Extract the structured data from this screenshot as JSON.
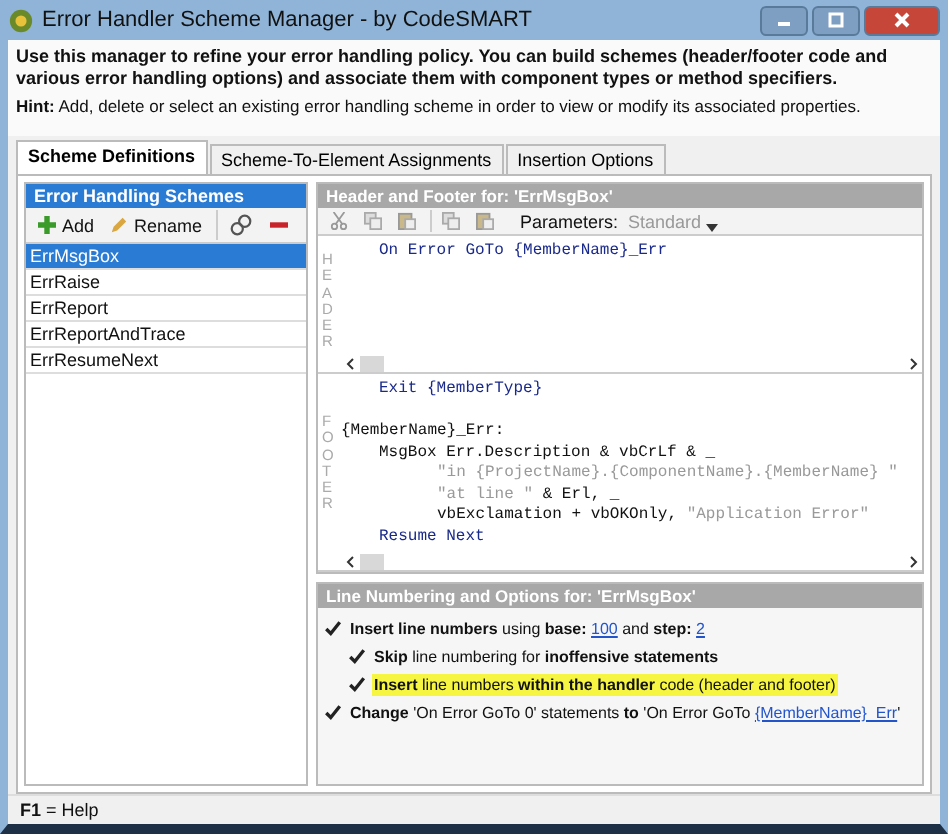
{
  "window": {
    "title": "Error Handler Scheme Manager - by CodeSMART"
  },
  "intro": {
    "description": "Use this manager to refine your error handling policy. You can build schemes (header/footer code and various error handling options) and associate them with component types or method specifiers.",
    "hint": "**Hint:** Add, delete or select an existing error handling scheme in order to view or modify its associated properties."
  },
  "tabs": [
    {
      "label": "Scheme Definitions",
      "selected": true
    },
    {
      "label": "Scheme-To-Element Assignments",
      "selected": false
    },
    {
      "label": "Insertion Options",
      "selected": false
    }
  ],
  "schemes": {
    "title": "Error Handling Schemes",
    "toolbar": [
      {
        "kind": "add",
        "label": "Add"
      },
      {
        "kind": "rename",
        "label": "Rename"
      },
      {
        "kind": "link"
      },
      {
        "kind": "delete"
      }
    ],
    "items": [
      {
        "label": "ErrMsgBox",
        "selected": true
      },
      {
        "label": "ErrRaise",
        "selected": false
      },
      {
        "label": "ErrReport",
        "selected": false
      },
      {
        "label": "ErrReportAndTrace",
        "selected": false
      },
      {
        "label": "ErrResumeNext",
        "selected": false
      }
    ]
  },
  "editor": {
    "title": "Header and Footer for: 'ErrMsgBox'",
    "toolbar": [
      {
        "kind": "cut"
      },
      {
        "kind": "copy"
      },
      {
        "kind": "paste"
      },
      {
        "kind": "copy"
      },
      {
        "kind": "paste"
      }
    ],
    "parameters_label": "Parameters:",
    "parameters_value": "Standard",
    "sections": [
      {
        "label": "HEADER",
        "lines": [
          {
            "kind": "statement",
            "segments": [
              {
                "kind": "keyword",
                "text": "On Error GoTo {MemberName}_Err"
              }
            ]
          }
        ]
      },
      {
        "label": "FOOTER",
        "lines": [
          {
            "kind": "statement",
            "segments": [
              {
                "kind": "keyword",
                "text": "Exit {MemberType}"
              }
            ]
          },
          {
            "kind": "blank"
          },
          {
            "kind": "label",
            "segments": [
              {
                "kind": "plain",
                "text": "{MemberName}_Err:"
              }
            ]
          },
          {
            "kind": "statement",
            "segments": [
              {
                "kind": "plain",
                "text": "MsgBox Err.Description & vbCrLf & _"
              }
            ]
          },
          {
            "kind": "continuation",
            "segments": [
              {
                "kind": "string",
                "text": "\"in {ProjectName}.{ComponentName}.{MemberName} \""
              }
            ]
          },
          {
            "kind": "continuation",
            "segments": [
              {
                "kind": "string",
                "text": "\"at line \""
              },
              {
                "kind": "plain",
                "text": " & Erl, _"
              }
            ]
          },
          {
            "kind": "continuation",
            "segments": [
              {
                "kind": "plain",
                "text": "vbExclamation + vbOKOnly, "
              },
              {
                "kind": "string",
                "text": "\"Application Error\""
              }
            ]
          },
          {
            "kind": "statement",
            "segments": [
              {
                "kind": "keyword",
                "text": "Resume Next"
              }
            ]
          }
        ]
      }
    ]
  },
  "options": {
    "title": "Line Numbering and Options for: 'ErrMsgBox'",
    "items": [
      {
        "checked": true,
        "highlighted": false,
        "parts": [
          {
            "kind": "text",
            "text": "**Insert line numbers** using **base:** "
          },
          {
            "kind": "link",
            "text": "100"
          },
          {
            "kind": "text",
            "text": " and **step:** "
          },
          {
            "kind": "link",
            "text": "2"
          }
        ],
        "children": [
          {
            "checked": true,
            "highlighted": false,
            "parts": [
              {
                "kind": "text",
                "text": "**Skip** line numbering for **inoffensive statements**"
              }
            ]
          },
          {
            "checked": true,
            "highlighted": true,
            "parts": [
              {
                "kind": "text",
                "text": "**Insert** line numbers **within the handler** code (header and footer)"
              }
            ]
          }
        ]
      },
      {
        "checked": true,
        "highlighted": false,
        "parts": [
          {
            "kind": "text",
            "text": "**Change** 'On Error GoTo 0' statements **to** 'On Error GoTo "
          },
          {
            "kind": "link",
            "text": "{MemberName}_Err"
          },
          {
            "kind": "text",
            "text": "'"
          }
        ]
      }
    ]
  },
  "status_bar": "**F1** = Help"
}
